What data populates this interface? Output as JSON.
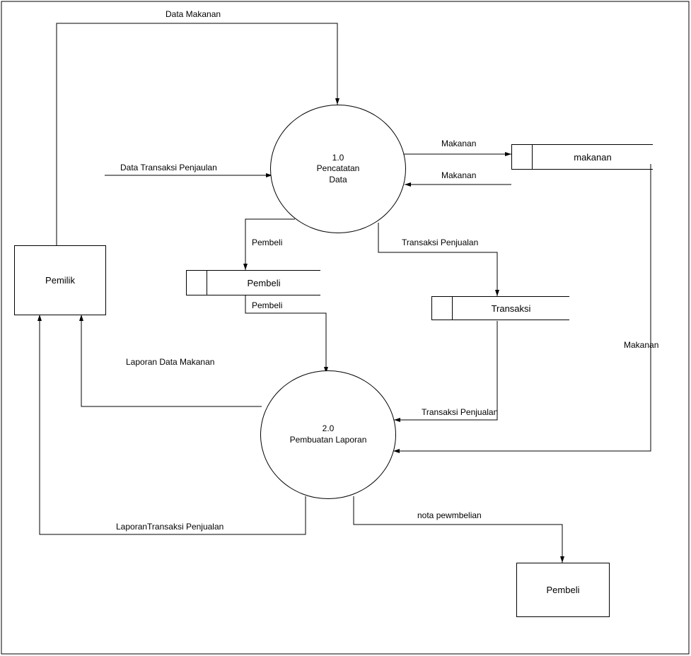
{
  "entities": {
    "pemilik": "Pemilik",
    "pembeli_ext": "Pembeli"
  },
  "processes": {
    "p1": {
      "id": "1.0",
      "name": "Pencatatan\nData"
    },
    "p2": {
      "id": "2.0",
      "name": "Pembuatan Laporan"
    }
  },
  "datastores": {
    "makanan": "makanan",
    "pembeli": "Pembeli",
    "transaksi": "Transaksi"
  },
  "flows": {
    "data_makanan": "Data Makanan",
    "data_transaksi_penjaulan": "Data Transaksi Penjaulan",
    "makanan_out": "Makanan",
    "makanan_in": "Makanan",
    "transaksi_penjualan": "Transaksi Penjualan",
    "pembeli_out": "Pembeli",
    "pembeli_in": "Pembeli",
    "transaksi_penjualan2": "Transaksi Penjualan",
    "makanan_down": "Makanan",
    "laporan_data_makanan": "Laporan Data Makanan",
    "laporan_transaksi_penjualan": "LaporanTransaksi  Penjualan",
    "nota_pewmbelian": "nota pewmbelian"
  }
}
